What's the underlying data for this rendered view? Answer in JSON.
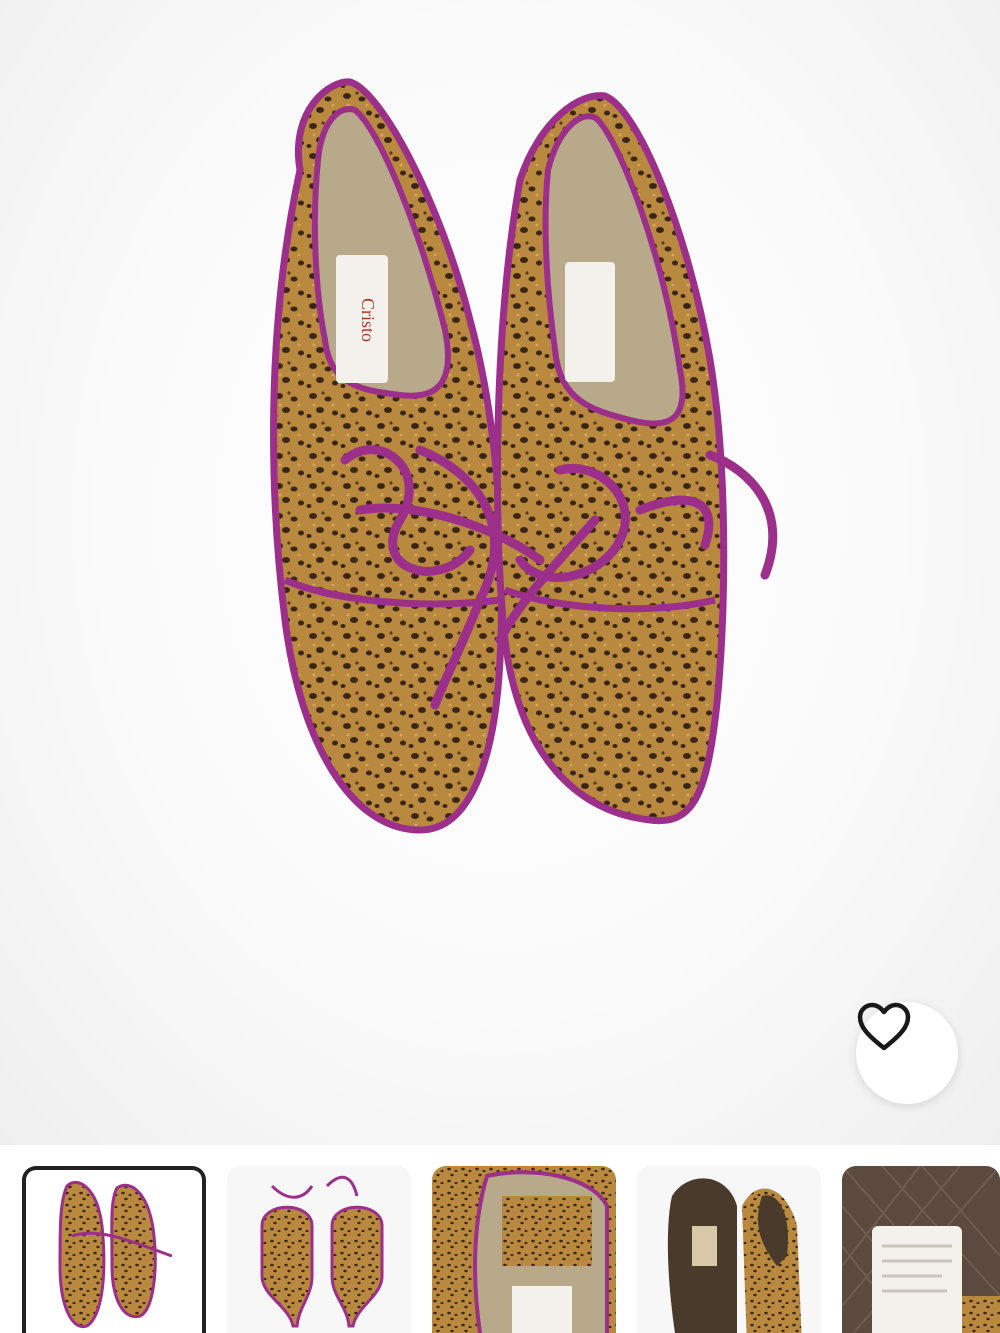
{
  "gallery": {
    "main_image": {
      "icon": "leopard-print-lace-up-shoes-image",
      "insole_brand_text": "Cristo"
    },
    "favorite": {
      "icon": "heart-outline-icon",
      "selected": false
    },
    "thumbnails": [
      {
        "icon": "shoes-top-view-thumbnail",
        "selected": true
      },
      {
        "icon": "shoes-back-view-thumbnail",
        "selected": false
      },
      {
        "icon": "shoe-insole-closeup-thumbnail",
        "selected": false
      },
      {
        "icon": "shoe-soles-thumbnail",
        "selected": false
      },
      {
        "icon": "label-tag-thumbnail",
        "selected": false
      }
    ]
  },
  "colors": {
    "leopard_base": "#b8893e",
    "leopard_spot": "#3b2614",
    "trim_purple": "#9c2f8a",
    "insole_gold": "#b7a98a",
    "label_white": "#f4f1ec"
  }
}
